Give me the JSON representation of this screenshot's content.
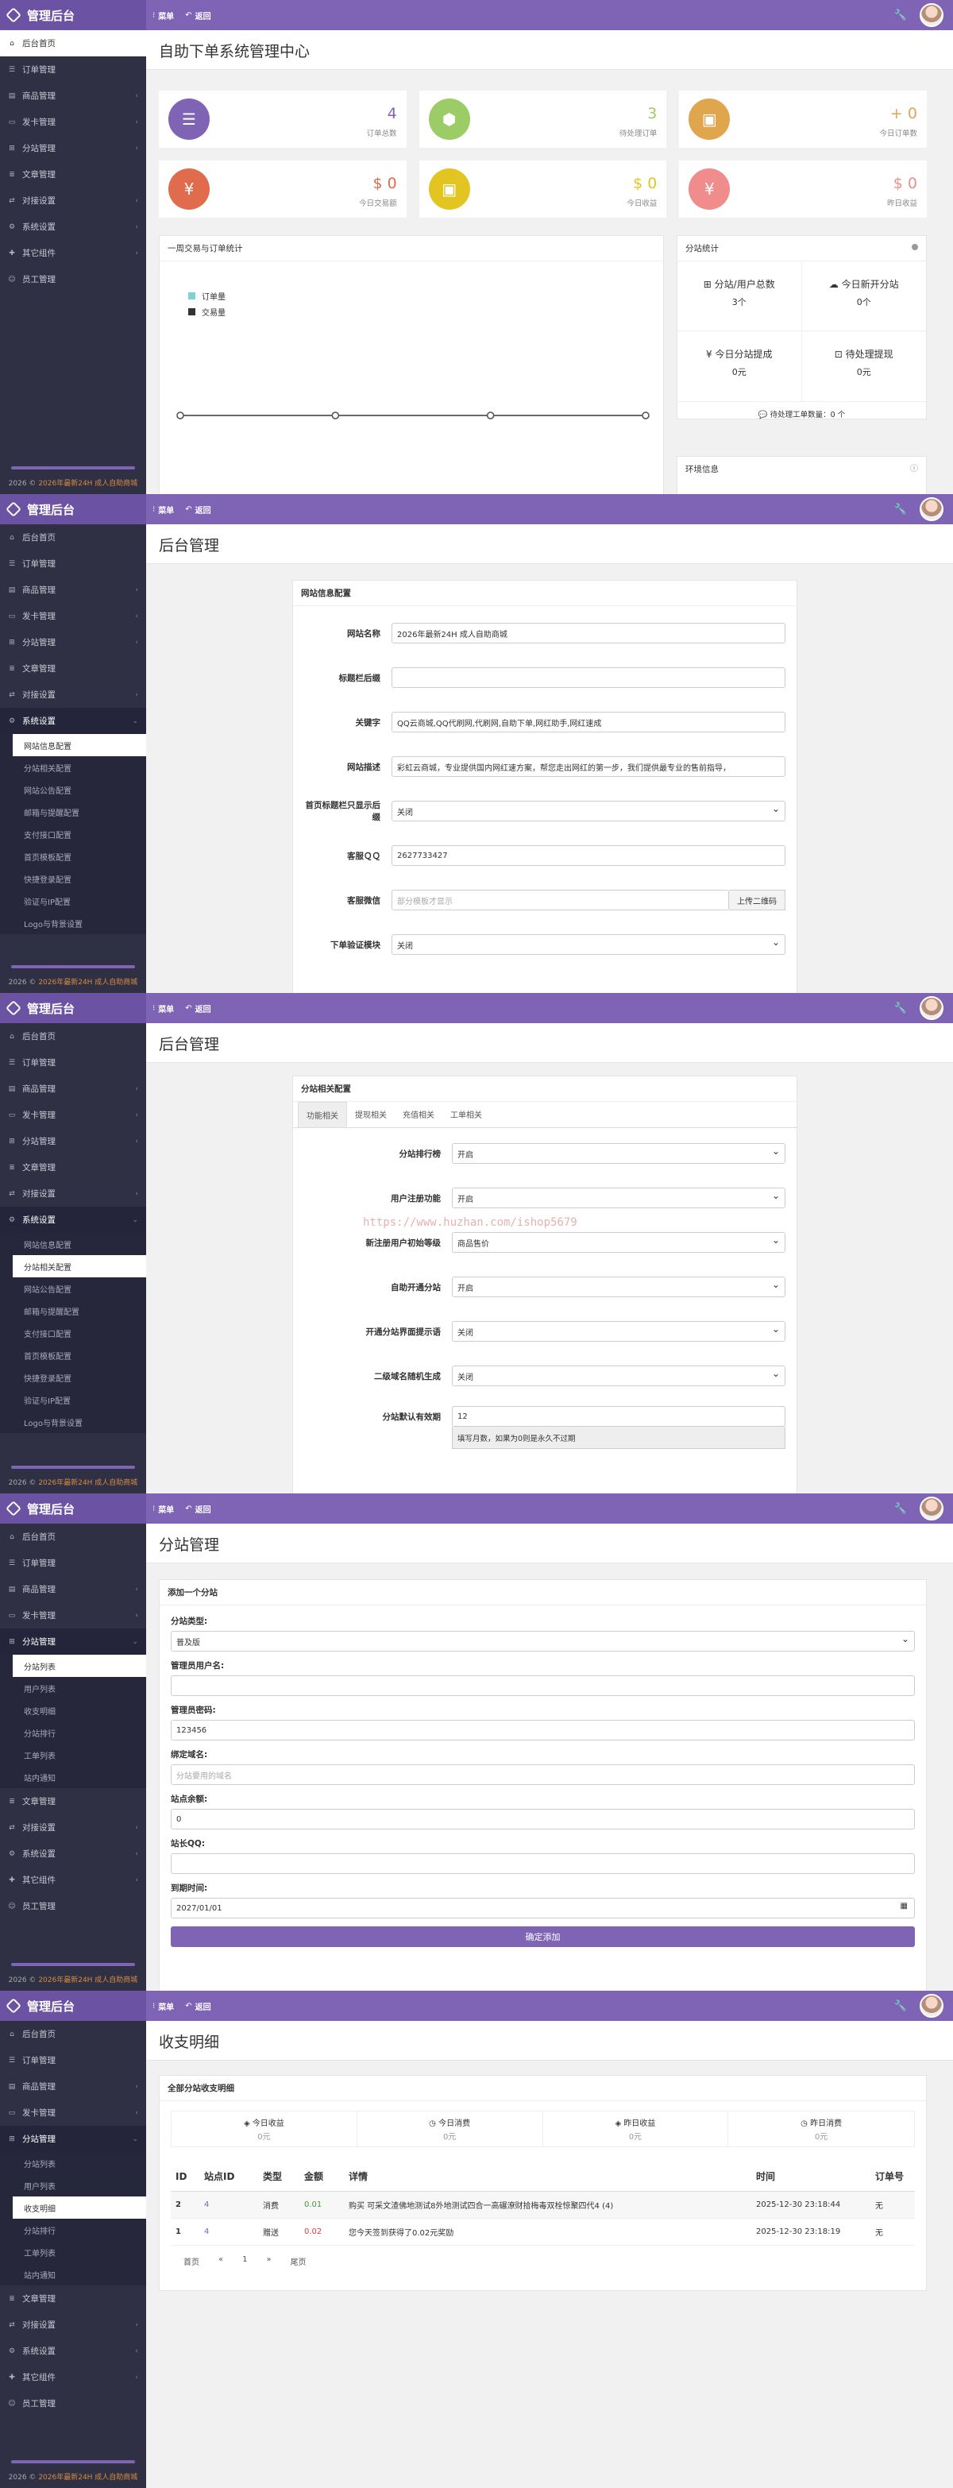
{
  "app": {
    "title": "管理后台",
    "menu_label": "菜单",
    "back_label": "返回"
  },
  "sidebar": {
    "home": "后台首页",
    "orders": "订单管理",
    "goods": "商品管理",
    "cards": "发卡管理",
    "branch": "分站管理",
    "article": "文章管理",
    "docking": "对接设置",
    "system": "系统设置",
    "plugins": "其它组件",
    "staff": "员工管理",
    "system_sub": [
      "网站信息配置",
      "分站相关配置",
      "网站公告配置",
      "邮箱与提醒配置",
      "支付接口配置",
      "首页模板配置",
      "快捷登录配置",
      "验证与IP配置",
      "Logo与背景设置"
    ],
    "branch_sub": [
      "分站列表",
      "用户列表",
      "收支明细",
      "分站排行",
      "工单列表",
      "站内通知"
    ],
    "footer_year": "2026 ©",
    "footer_name": "2026年最新24H 成人自助商城"
  },
  "dashboard": {
    "title": "自助下单系统管理中心",
    "stats": [
      {
        "value": "4",
        "label": "订单总数",
        "color": "#7f64b5",
        "icon": "list-icon"
      },
      {
        "value": "3",
        "label": "待处理订单",
        "color": "#9ccc65",
        "icon": "box-icon"
      },
      {
        "value": "+ 0",
        "label": "今日订单数",
        "color": "#e0a64e",
        "icon": "briefcase-icon"
      },
      {
        "value": "$ 0",
        "label": "今日交易额",
        "color": "#e06b4d",
        "icon": "yen-icon"
      },
      {
        "value": "$ 0",
        "label": "今日收益",
        "color": "#e3c522",
        "icon": "briefcase-icon"
      },
      {
        "value": "$ 0",
        "label": "昨日收益",
        "color": "#f08c8c",
        "icon": "yen-icon"
      }
    ],
    "chart_title": "一周交易与订单统计",
    "legend": [
      "订单量",
      "交易量"
    ],
    "branch_title": "分站统计",
    "branch_stats": [
      {
        "label": "分站/用户总数",
        "value": "3个"
      },
      {
        "label": "今日新开分站",
        "value": "0个"
      },
      {
        "label": "今日分站提成",
        "value": "0元"
      },
      {
        "label": "待处理提现",
        "value": "0元"
      }
    ],
    "tickets": "待处理工单数量：0 个",
    "env_title": "环境信息",
    "chart_data": {
      "type": "line",
      "x": [
        "",
        "",
        "",
        ""
      ],
      "series": [
        {
          "name": "订单量",
          "values": [
            0,
            0,
            0,
            0
          ]
        },
        {
          "name": "交易量",
          "values": [
            0,
            0,
            0,
            0
          ]
        }
      ]
    }
  },
  "admin_title": "后台管理",
  "site_config": {
    "panel_title": "网站信息配置",
    "fields": [
      {
        "label": "网站名称",
        "value": "2026年最新24H 成人自助商城"
      },
      {
        "label": "标题栏后缀",
        "value": ""
      },
      {
        "label": "关键字",
        "value": "QQ云商城,QQ代刷网,代刷网,自助下单,网红助手,网红速成"
      },
      {
        "label": "网站描述",
        "value": "彩虹云商城，专业提供国内网红速方案，帮您走出网红的第一步，我们提供最专业的售前指导，"
      },
      {
        "label": "首页标题栏只显示后缀",
        "value": "关闭"
      },
      {
        "label": "客服ＱＱ",
        "value": "2627733427"
      },
      {
        "label": "客服微信",
        "placeholder": "部分模板才显示",
        "button": "上传二维码"
      },
      {
        "label": "下单验证模块",
        "value": "关闭"
      }
    ]
  },
  "branch_config": {
    "panel_title": "分站相关配置",
    "tabs": [
      "功能相关",
      "提现相关",
      "充值相关",
      "工单相关"
    ],
    "fields": [
      {
        "label": "分站排行榜",
        "value": "开启"
      },
      {
        "label": "用户注册功能",
        "value": "开启"
      },
      {
        "label": "新注册用户初始等级",
        "value": "商品售价"
      },
      {
        "label": "自助开通分站",
        "value": "开启"
      },
      {
        "label": "开通分站界面提示语",
        "value": "关闭"
      },
      {
        "label": "二级域名随机生成",
        "value": "关闭"
      },
      {
        "label": "分站默认有效期",
        "value": "12"
      }
    ],
    "hint": "填写月数，如果为0则是永久不过期",
    "watermark": "https://www.huzhan.com/ishop5679"
  },
  "branch_manage": {
    "title": "分站管理",
    "panel_title": "添加一个分站",
    "fields": [
      {
        "label": "分站类型:",
        "value": "普及版"
      },
      {
        "label": "管理员用户名:",
        "value": ""
      },
      {
        "label": "管理员密码:",
        "value": "123456"
      },
      {
        "label": "绑定域名:",
        "placeholder": "分站要用的域名"
      },
      {
        "label": "站点余额:",
        "value": "0"
      },
      {
        "label": "站长QQ:",
        "value": ""
      },
      {
        "label": "到期时间:",
        "value": "2027/01/01"
      }
    ],
    "submit": "确定添加"
  },
  "ledger": {
    "title": "收支明细",
    "panel_title": "全部分站收支明细",
    "summary": [
      {
        "label": "今日收益",
        "value": "0元"
      },
      {
        "label": "今日消费",
        "value": "0元"
      },
      {
        "label": "昨日收益",
        "value": "0元"
      },
      {
        "label": "昨日消费",
        "value": "0元"
      }
    ],
    "headers": [
      "ID",
      "站点ID",
      "类型",
      "金额",
      "详情",
      "时间",
      "订单号"
    ],
    "rows": [
      {
        "id": "2",
        "site": "4",
        "type": "消费",
        "amount": "0.01",
        "amount_color": "#3c9a3c",
        "detail": "购买 可采文渣佛地测试8外地测试四合一高碾潦财拾梅毒双栓惊聚四代4 (4)",
        "time": "2025-12-30 23:18:44",
        "order": "无"
      },
      {
        "id": "1",
        "site": "4",
        "type": "赠送",
        "amount": "0.02",
        "amount_color": "#e03c3c",
        "detail": "您今天签到获得了0.02元奖励",
        "time": "2025-12-30 23:18:19",
        "order": "无"
      }
    ],
    "pager": [
      "首页",
      "«",
      "1",
      "»",
      "尾页"
    ]
  }
}
